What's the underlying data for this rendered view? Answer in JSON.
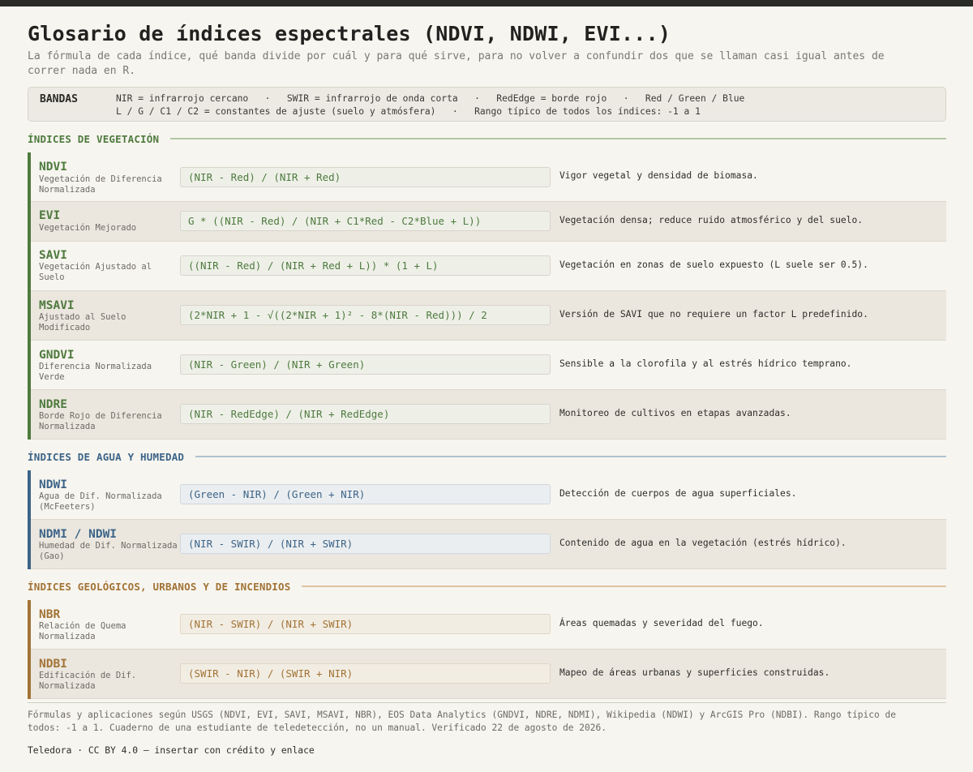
{
  "title": "Glosario de índices espectrales (NDVI, NDWI, EVI...)",
  "subtitle": "La fórmula de cada índice, qué banda divide por cuál y para qué sirve, para no volver a confundir dos que se llaman casi igual antes de correr nada en R.",
  "bands": {
    "label": "BANDAS",
    "line1": "NIR = infrarrojo cercano   ·   SWIR = infrarrojo de onda corta   ·   RedEdge = borde rojo   ·   Red / Green / Blue",
    "line2": "L / G / C1 / C2 = constantes de ajuste (suelo y atmósfera)   ·   Rango típico de todos los índices: -1 a 1"
  },
  "sections": {
    "vegetation": {
      "title": "ÍNDICES DE VEGETACIÓN",
      "rows": [
        {
          "name": "NDVI",
          "full": "Vegetación de Diferencia Normalizada",
          "formula": "(NIR - Red) / (NIR + Red)",
          "desc": "Vigor vegetal y densidad de biomasa."
        },
        {
          "name": "EVI",
          "full": "Vegetación Mejorado",
          "formula": "G * ((NIR - Red) / (NIR + C1*Red - C2*Blue + L))",
          "desc": "Vegetación densa; reduce ruido atmosférico y del suelo."
        },
        {
          "name": "SAVI",
          "full": "Vegetación Ajustado al Suelo",
          "formula": "((NIR - Red) / (NIR + Red + L)) * (1 + L)",
          "desc": "Vegetación en zonas de suelo expuesto (L suele ser 0.5)."
        },
        {
          "name": "MSAVI",
          "full": "Ajustado al Suelo Modificado",
          "formula": "(2*NIR + 1 - √((2*NIR + 1)² - 8*(NIR - Red))) / 2",
          "desc": "Versión de SAVI que no requiere un factor L predefinido."
        },
        {
          "name": "GNDVI",
          "full": "Diferencia Normalizada Verde",
          "formula": "(NIR - Green) / (NIR + Green)",
          "desc": "Sensible a la clorofila y al estrés hídrico temprano."
        },
        {
          "name": "NDRE",
          "full": "Borde Rojo de Diferencia Normalizada",
          "formula": "(NIR - RedEdge) / (NIR + RedEdge)",
          "desc": "Monitoreo de cultivos en etapas avanzadas."
        }
      ]
    },
    "water": {
      "title": "ÍNDICES DE AGUA Y HUMEDAD",
      "rows": [
        {
          "name": "NDWI",
          "full": "Agua de Dif. Normalizada (McFeeters)",
          "formula": "(Green - NIR) / (Green + NIR)",
          "desc": "Detección de cuerpos de agua superficiales."
        },
        {
          "name": "NDMI / NDWI",
          "full": "Humedad de Dif. Normalizada (Gao)",
          "formula": "(NIR - SWIR) / (NIR + SWIR)",
          "desc": "Contenido de agua en la vegetación (estrés hídrico)."
        }
      ]
    },
    "geo": {
      "title": "ÍNDICES GEOLÓGICOS, URBANOS Y DE INCENDIOS",
      "rows": [
        {
          "name": "NBR",
          "full": "Relación de Quema Normalizada",
          "formula": "(NIR - SWIR) / (NIR + SWIR)",
          "desc": "Áreas quemadas y severidad del fuego."
        },
        {
          "name": "NDBI",
          "full": "Edificación de Dif. Normalizada",
          "formula": "(SWIR - NIR) / (SWIR + NIR)",
          "desc": "Mapeo de áreas urbanas y superficies construidas."
        }
      ]
    }
  },
  "notes": "Fórmulas y aplicaciones según USGS (NDVI, EVI, SAVI, MSAVI, NBR), EOS Data Analytics (GNDVI, NDRE, NDMI), Wikipedia (NDWI) y ArcGIS Pro (NDBI). Rango típico de todos: -1 a 1. Cuaderno de una estudiante de teledetección, no un manual. Verificado 22 de agosto de 2026.",
  "credit": "Teledora · CC BY 4.0 — insertar con crédito y enlace"
}
